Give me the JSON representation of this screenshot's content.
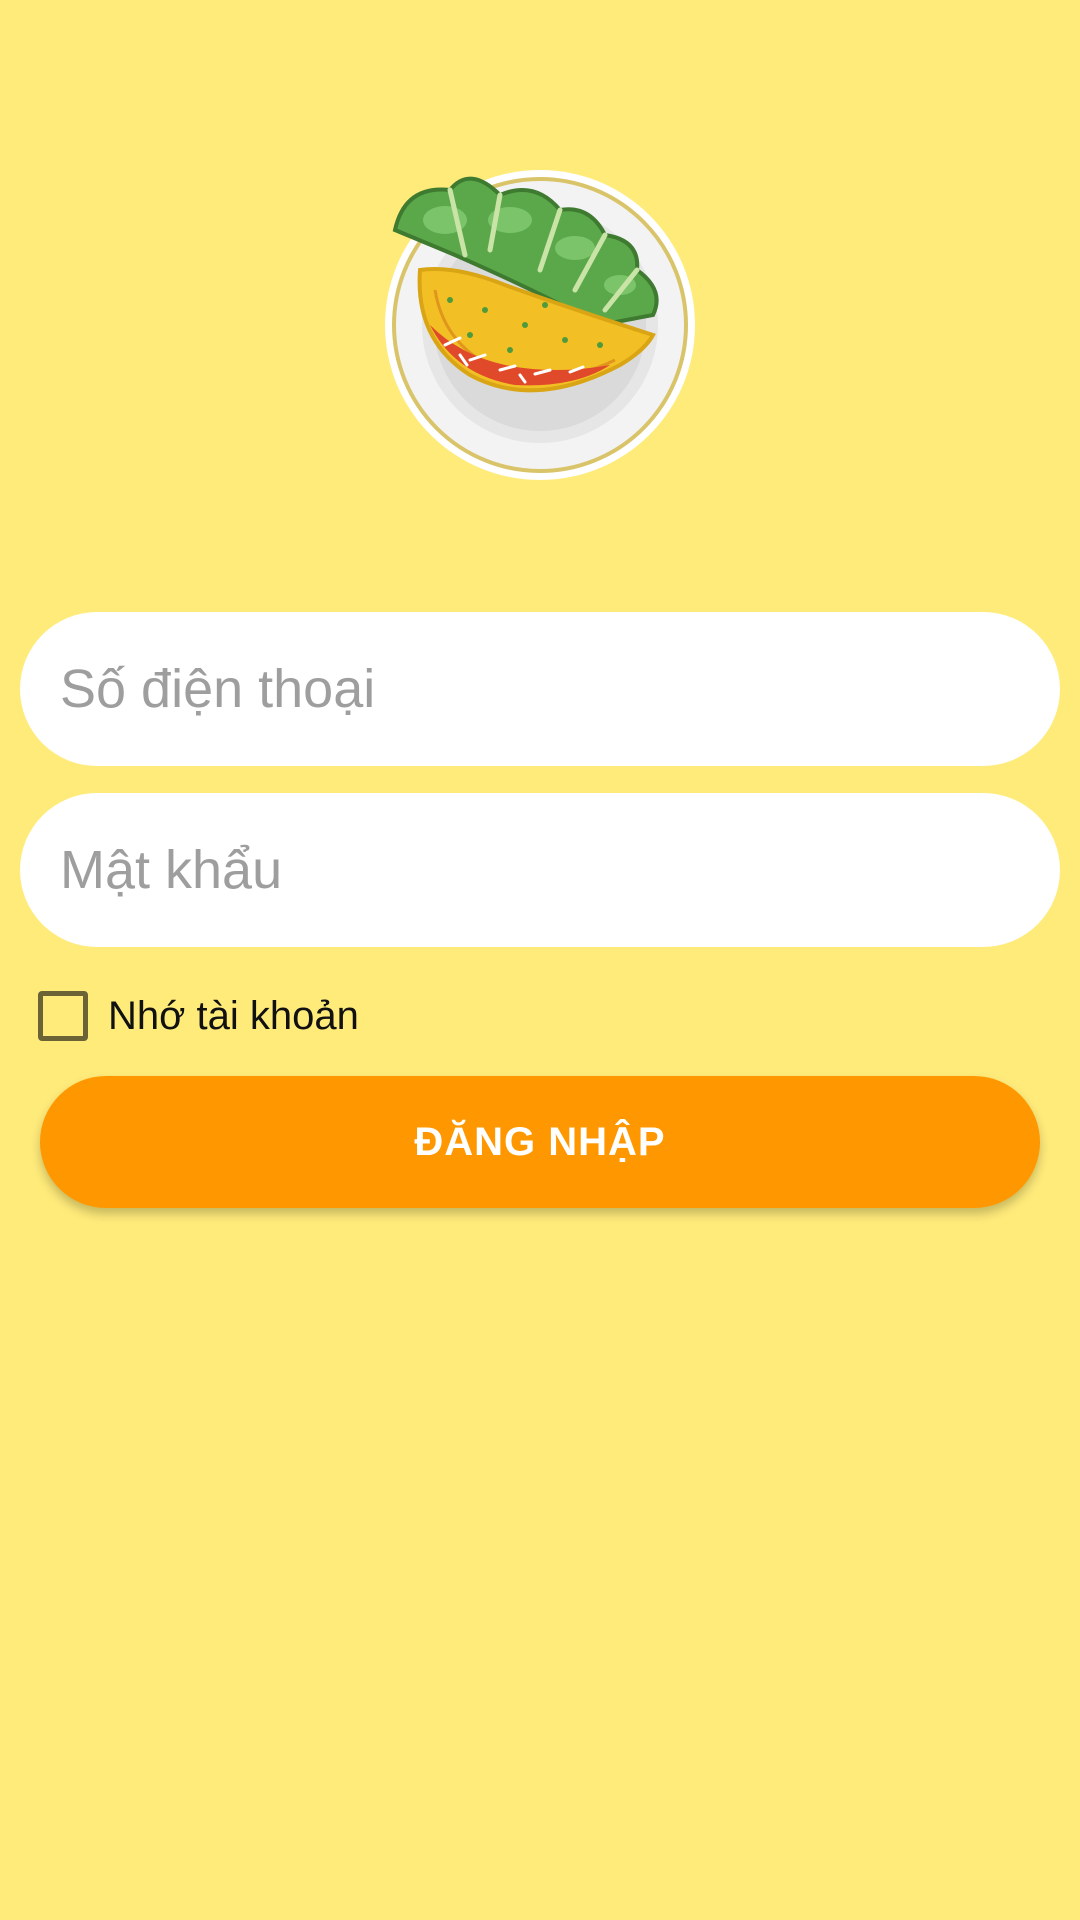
{
  "logo": {
    "icon": "banh-xeo-plate-icon"
  },
  "form": {
    "phone_placeholder": "Số điện thoại",
    "phone_value": "",
    "password_placeholder": "Mật khẩu",
    "password_value": "",
    "remember_label": "Nhớ tài khoản",
    "remember_checked": false,
    "login_label": "ĐĂNG NHẬP"
  },
  "colors": {
    "background": "#FFEB7A",
    "field": "#FFFFFF",
    "placeholder": "#9E9E9E",
    "button": "#FF9800",
    "button_text": "#FFFFFF",
    "checkbox_border": "#6B6236"
  }
}
